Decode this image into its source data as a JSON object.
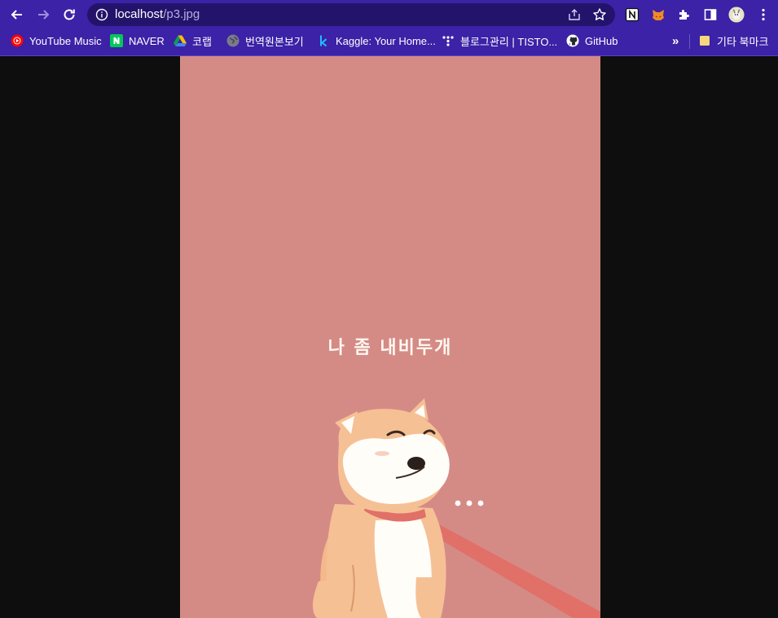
{
  "browser": {
    "url": {
      "host": "localhost",
      "path": "/p3.jpg"
    }
  },
  "bookmarks": [
    {
      "label": "YouTube Music",
      "icon": "youtube-music-icon"
    },
    {
      "label": "NAVER",
      "icon": "naver-icon"
    },
    {
      "label": "코랩",
      "icon": "google-drive-icon"
    },
    {
      "label": "번역원본보기",
      "icon": "globe-icon"
    },
    {
      "label": "Kaggle: Your Home...",
      "icon": "kaggle-icon"
    },
    {
      "label": "블로그관리 | TISTO...",
      "icon": "tistory-icon"
    },
    {
      "label": "GitHub",
      "icon": "github-icon"
    }
  ],
  "bookmarks_overflow": "»",
  "other_bookmarks": "기타 북마크",
  "image": {
    "caption": "나 좀 내비두개",
    "ellipsis": "• • •"
  },
  "colors": {
    "toolbar": "#3b22a6",
    "omnibox": "#24136b",
    "image_background": "#d58b85",
    "page_background": "#0e0e0e"
  }
}
